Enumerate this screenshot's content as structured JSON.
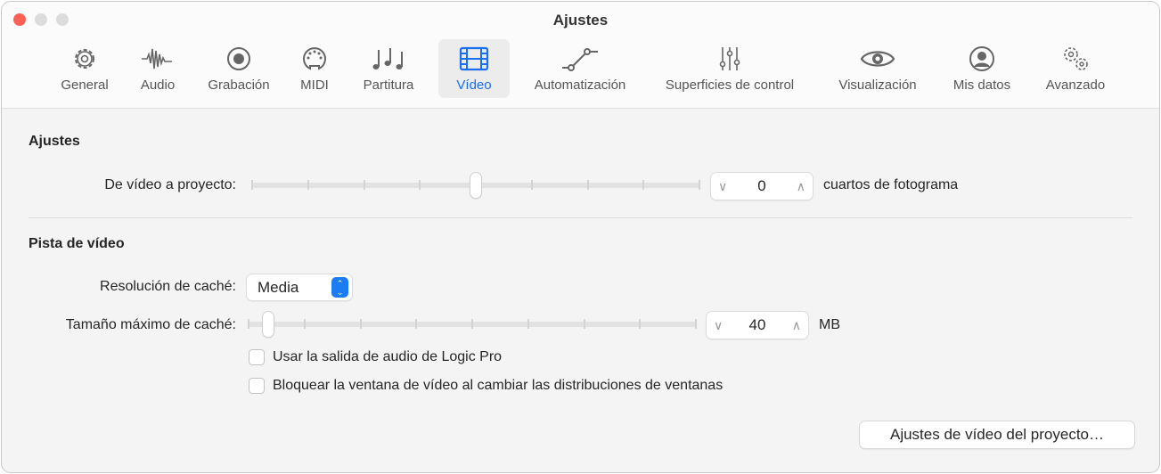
{
  "window": {
    "title": "Ajustes"
  },
  "tabs": [
    {
      "label": "General",
      "icon": "gear-icon"
    },
    {
      "label": "Audio",
      "icon": "waveform-icon"
    },
    {
      "label": "Grabación",
      "icon": "record-icon"
    },
    {
      "label": "MIDI",
      "icon": "midi-port-icon"
    },
    {
      "label": "Partitura",
      "icon": "notes-icon"
    },
    {
      "label": "Vídeo",
      "icon": "film-icon",
      "active": true
    },
    {
      "label": "Automatización",
      "icon": "automation-icon"
    },
    {
      "label": "Superficies de control",
      "icon": "faders-icon"
    },
    {
      "label": "Visualización",
      "icon": "eye-icon"
    },
    {
      "label": "Mis datos",
      "icon": "person-icon"
    },
    {
      "label": "Avanzado",
      "icon": "gears-icon"
    }
  ],
  "ajustes": {
    "heading": "Ajustes",
    "video_to_project_label": "De vídeo a proyecto:",
    "slider_fraction": 0.5,
    "value": "0",
    "unit": "cuartos de fotograma"
  },
  "pista": {
    "heading": "Pista de vídeo",
    "resolution_label": "Resolución de caché:",
    "resolution_value": "Media",
    "max_cache_label": "Tamaño máximo de caché:",
    "cache_slider_fraction": 0.045,
    "cache_value": "40",
    "cache_unit": "MB",
    "checkbox_audio": "Usar la salida de audio de Logic Pro",
    "checkbox_lock": "Bloquear la ventana de vídeo al cambiar las distribuciones de ventanas"
  },
  "project_video_button": "Ajustes de vídeo del proyecto…",
  "colors": {
    "accent": "#1a6ff0",
    "close": "#fe5f57"
  }
}
